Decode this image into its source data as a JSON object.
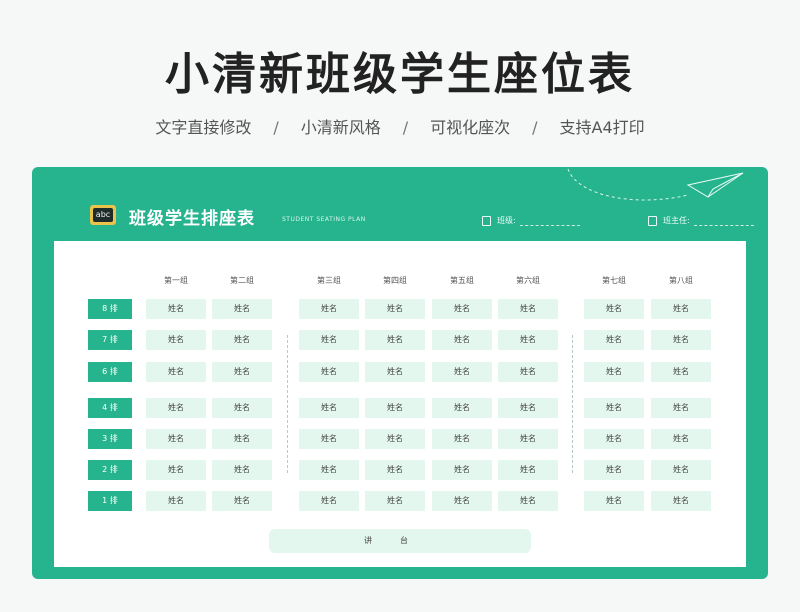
{
  "header": {
    "title": "小清新班级学生座位表",
    "features": [
      "文字直接修改",
      "小清新风格",
      "可视化座次",
      "支持A4打印"
    ],
    "separator": "/"
  },
  "sheet": {
    "title": "班级学生排座表",
    "subtitle": "STUDENT SEATING PLAN",
    "badge_text": "abc",
    "class_label": "班级:",
    "teacher_label": "班主任:",
    "podium": "讲台"
  },
  "groups": [
    "第一组",
    "第二组",
    "第三组",
    "第四组",
    "第五组",
    "第六组",
    "第七组",
    "第八组"
  ],
  "rows": [
    "8 排",
    "7 排",
    "6 排",
    "4 排",
    "3 排",
    "2 排",
    "1 排"
  ],
  "seat_text": "姓名",
  "colors": {
    "accent": "#26b48f",
    "seat": "#e3f7ee",
    "badge": "#e9c34a"
  }
}
